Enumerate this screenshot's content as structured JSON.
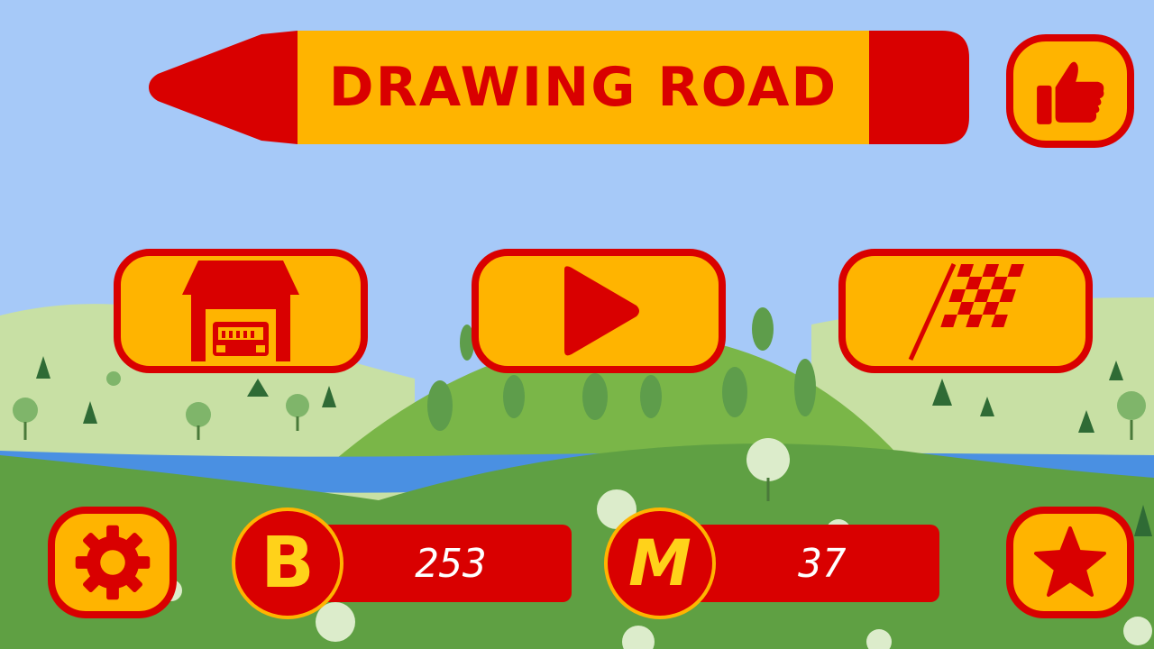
{
  "app": {
    "title": "DRAWING ROAD"
  },
  "colors": {
    "sky": "#a6c9f8",
    "red": "#d90000",
    "yellow": "#ffb400",
    "river": "#4a90e2",
    "hill_dark": "#5fa043",
    "hill_light": "#c8e0a4",
    "hill_mid": "#7ab648"
  },
  "main_menu": {
    "garage_icon": "garage-car-icon",
    "play_icon": "play-icon",
    "levels_icon": "checkered-flag-icon"
  },
  "side_buttons": {
    "like_icon": "thumbs-up-icon",
    "settings_icon": "gear-icon",
    "rate_icon": "star-icon"
  },
  "currency": {
    "coins": {
      "icon": "bitcoin-icon",
      "glyph": "B",
      "value": "253"
    },
    "distance": {
      "icon": "m-badge-icon",
      "glyph": "M",
      "value": "37"
    }
  }
}
